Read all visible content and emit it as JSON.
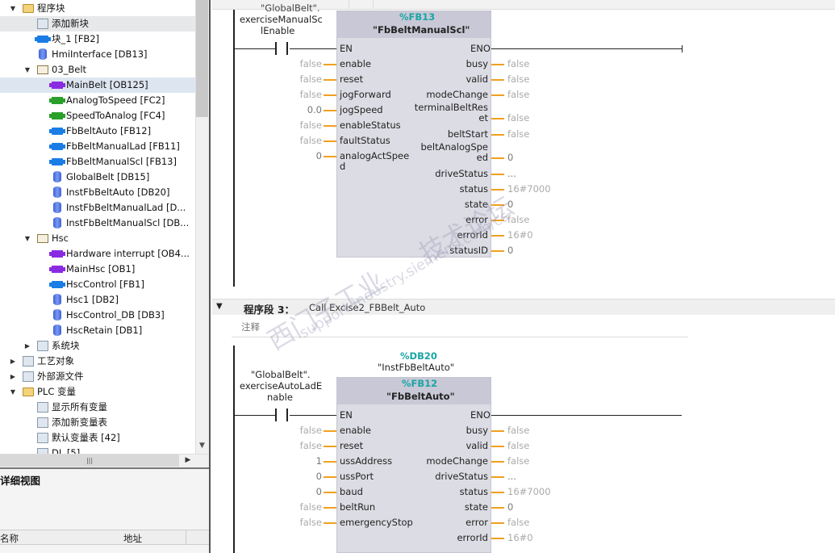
{
  "tree": {
    "items": [
      {
        "label": "程序块",
        "expanded": true,
        "icon": "folder-icon"
      },
      {
        "label": "添加新块",
        "icon": "add-block-icon"
      },
      {
        "label": "块_1 [FB2]",
        "icon": "fb-icon"
      },
      {
        "label": "HmiInterface [DB13]",
        "icon": "db-icon"
      },
      {
        "label": "03_Belt",
        "expanded": true,
        "icon": "folder-icon"
      },
      {
        "label": "MainBelt [OB125]",
        "icon": "ob-icon"
      },
      {
        "label": "AnalogToSpeed [FC2]",
        "icon": "fc-icon"
      },
      {
        "label": "SpeedToAnalog [FC4]",
        "icon": "fc-icon"
      },
      {
        "label": "FbBeltAuto [FB12]",
        "icon": "fb-icon"
      },
      {
        "label": "FbBeltManualLad [FB11]",
        "icon": "fb-icon"
      },
      {
        "label": "FbBeltManualScl [FB13]",
        "icon": "fb-icon"
      },
      {
        "label": "GlobalBelt [DB15]",
        "icon": "db-icon"
      },
      {
        "label": "InstFbBeltAuto [DB20]",
        "icon": "db-icon"
      },
      {
        "label": "InstFbBeltManualLad [D...",
        "icon": "db-icon"
      },
      {
        "label": "InstFbBeltManualScl [DB...",
        "icon": "db-icon"
      },
      {
        "label": "Hsc",
        "expanded": true,
        "icon": "folder-icon"
      },
      {
        "label": "Hardware interrupt [OB4...",
        "icon": "ob-icon"
      },
      {
        "label": "MainHsc [OB1]",
        "icon": "ob-icon"
      },
      {
        "label": "HscControl [FB1]",
        "icon": "fb-icon"
      },
      {
        "label": "Hsc1 [DB2]",
        "icon": "db-icon"
      },
      {
        "label": "HscControl_DB [DB3]",
        "icon": "db-icon"
      },
      {
        "label": "HscRetain [DB1]",
        "icon": "db-icon"
      },
      {
        "label": "系统块",
        "expanded": false,
        "icon": "system-folder-icon"
      },
      {
        "label": "工艺对象",
        "expanded": false,
        "icon": "tech-object-icon"
      },
      {
        "label": "外部源文件",
        "expanded": false,
        "icon": "external-source-icon"
      },
      {
        "label": "PLC 变量",
        "expanded": true,
        "icon": "plc-tags-icon"
      },
      {
        "label": "显示所有变量",
        "icon": "show-tags-icon"
      },
      {
        "label": "添加新变量表",
        "icon": "add-tag-table-icon"
      },
      {
        "label": "默认变量表 [42]",
        "icon": "tag-table-icon"
      },
      {
        "label": "DL [5]",
        "icon": "tag-table-icon"
      }
    ]
  },
  "detail": {
    "title": "详细视图",
    "col_name": "名称",
    "col_address": "地址"
  },
  "network2": {
    "contact_tag_top": "\"GlobalBelt\".",
    "contact_tag": "exerciseManualSc",
    "contact_tag2": "lEnable",
    "block_number": "%FB13",
    "block_name": "\"FbBeltManualScl\"",
    "in_en": "EN",
    "out_eno": "ENO",
    "inputs": [
      {
        "val": "false",
        "name": "enable"
      },
      {
        "val": "false",
        "name": "reset"
      },
      {
        "val": "false",
        "name": "jogForward"
      },
      {
        "val": "0.0",
        "name": "jogSpeed"
      },
      {
        "val": "false",
        "name": "enableStatus"
      },
      {
        "val": "false",
        "name": "faultStatus"
      },
      {
        "val": "0",
        "name": "analogActSpee",
        "name2": "d"
      }
    ],
    "outputs": [
      {
        "name": "busy",
        "val": "false"
      },
      {
        "name": "valid",
        "val": "false"
      },
      {
        "name": "modeChange",
        "val": "false"
      },
      {
        "name": "terminalBeltRes",
        "name2": "et",
        "val": "false"
      },
      {
        "name": "beltStart",
        "val": "false"
      },
      {
        "name": "beltAnalogSpe",
        "name2": "ed",
        "val": "0"
      },
      {
        "name": "driveStatus",
        "val": "..."
      },
      {
        "name": "status",
        "val": "16#7000"
      },
      {
        "name": "state",
        "val": "0"
      },
      {
        "name": "error",
        "val": "false"
      },
      {
        "name": "errorId",
        "val": "16#0"
      },
      {
        "name": "statusID",
        "val": "0"
      }
    ]
  },
  "network3": {
    "header_label": "程序段 3：",
    "header_comment": "Call Excise2_FBBelt_Auto",
    "comment": "注释",
    "instance_db": "%DB20",
    "instance_name": "\"InstFbBeltAuto\"",
    "contact_tag": "\"GlobalBelt\".",
    "contact_tag2": "exerciseAutoLadE",
    "contact_tag3": "nable",
    "block_number": "%FB12",
    "block_name": "\"FbBeltAuto\"",
    "in_en": "EN",
    "out_eno": "ENO",
    "inputs": [
      {
        "val": "false",
        "name": "enable"
      },
      {
        "val": "false",
        "name": "reset"
      },
      {
        "val": "1",
        "name": "ussAddress"
      },
      {
        "val": "0",
        "name": "ussPort"
      },
      {
        "val": "0",
        "name": "baud"
      },
      {
        "val": "false",
        "name": "beltRun"
      },
      {
        "val": "false",
        "name": "emergencyStop"
      }
    ],
    "outputs": [
      {
        "name": "busy",
        "val": "false"
      },
      {
        "name": "valid",
        "val": "false"
      },
      {
        "name": "modeChange",
        "val": "false"
      },
      {
        "name": "driveStatus",
        "val": "..."
      },
      {
        "name": "status",
        "val": "16#7000"
      },
      {
        "name": "state",
        "val": "0"
      },
      {
        "name": "error",
        "val": "false"
      },
      {
        "name": "errorId",
        "val": "16#0"
      }
    ]
  },
  "watermark": {
    "text1": "西门子工业",
    "text2": "support.industry.siemens.com/cs",
    "text3": "技术论坛"
  }
}
